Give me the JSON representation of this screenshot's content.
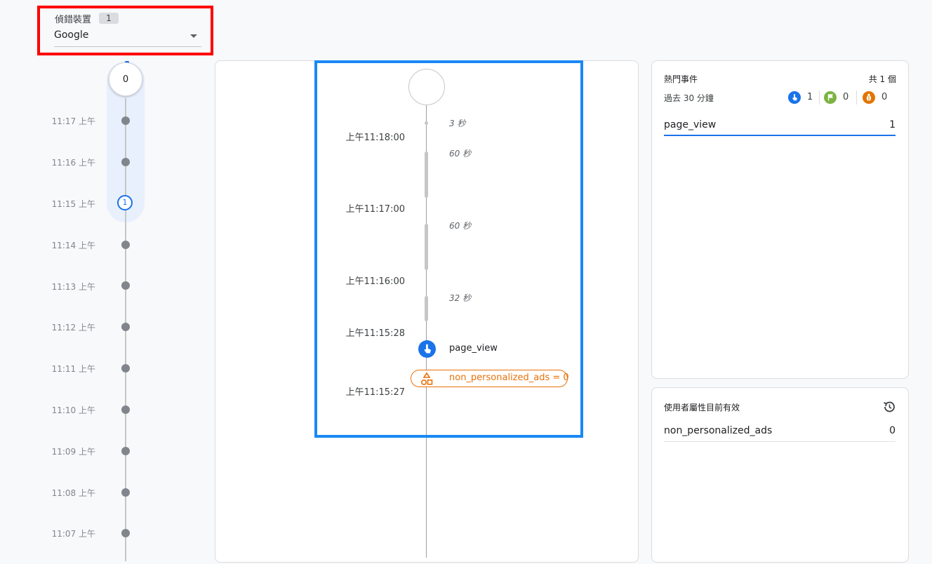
{
  "device_selector": {
    "label": "偵錯裝置",
    "count": "1",
    "selected_value": "Google"
  },
  "minute_timeline": {
    "top_count": "0",
    "items": [
      {
        "time": "11:17 上午"
      },
      {
        "time": "11:16 上午"
      },
      {
        "time": "11:15 上午",
        "count": "1"
      },
      {
        "time": "11:14 上午"
      },
      {
        "time": "11:13 上午"
      },
      {
        "time": "11:12 上午"
      },
      {
        "time": "11:11 上午"
      },
      {
        "time": "11:10 上午"
      },
      {
        "time": "11:09 上午"
      },
      {
        "time": "11:08 上午"
      },
      {
        "time": "11:07 上午"
      }
    ]
  },
  "seconds_stream": {
    "times": [
      "上午11:18:00",
      "上午11:17:00",
      "上午11:16:00",
      "上午11:15:28",
      "上午11:15:27"
    ],
    "gaps": [
      "3 秒",
      "60 秒",
      "60 秒",
      "32 秒"
    ],
    "event_name": "page_view",
    "user_property_change": "non_personalized_ads = 0"
  },
  "top_events": {
    "title": "熱門事件",
    "total": "共 1 個",
    "period": "過去 30 分鐘",
    "counts": {
      "events": "1",
      "conversions": "0",
      "errors": "0"
    },
    "rows": [
      {
        "name": "page_view",
        "count": "1"
      }
    ]
  },
  "user_properties": {
    "title": "使用者屬性目前有效",
    "rows": [
      {
        "name": "non_personalized_ads",
        "value": "0"
      }
    ]
  },
  "colors": {
    "accent": "#1a73e8",
    "highlight_red": "#ff0000",
    "highlight_blue": "#1a88f5",
    "property_orange": "#e8710a",
    "conversion_green": "#7cb342",
    "error_orange": "#e37400"
  },
  "icons": {
    "dropdown": "triangle-down-icon",
    "event": "touch-icon",
    "conversion": "flag-icon",
    "error": "bug-icon",
    "user_property": "shapes-icon",
    "history": "history-icon"
  }
}
